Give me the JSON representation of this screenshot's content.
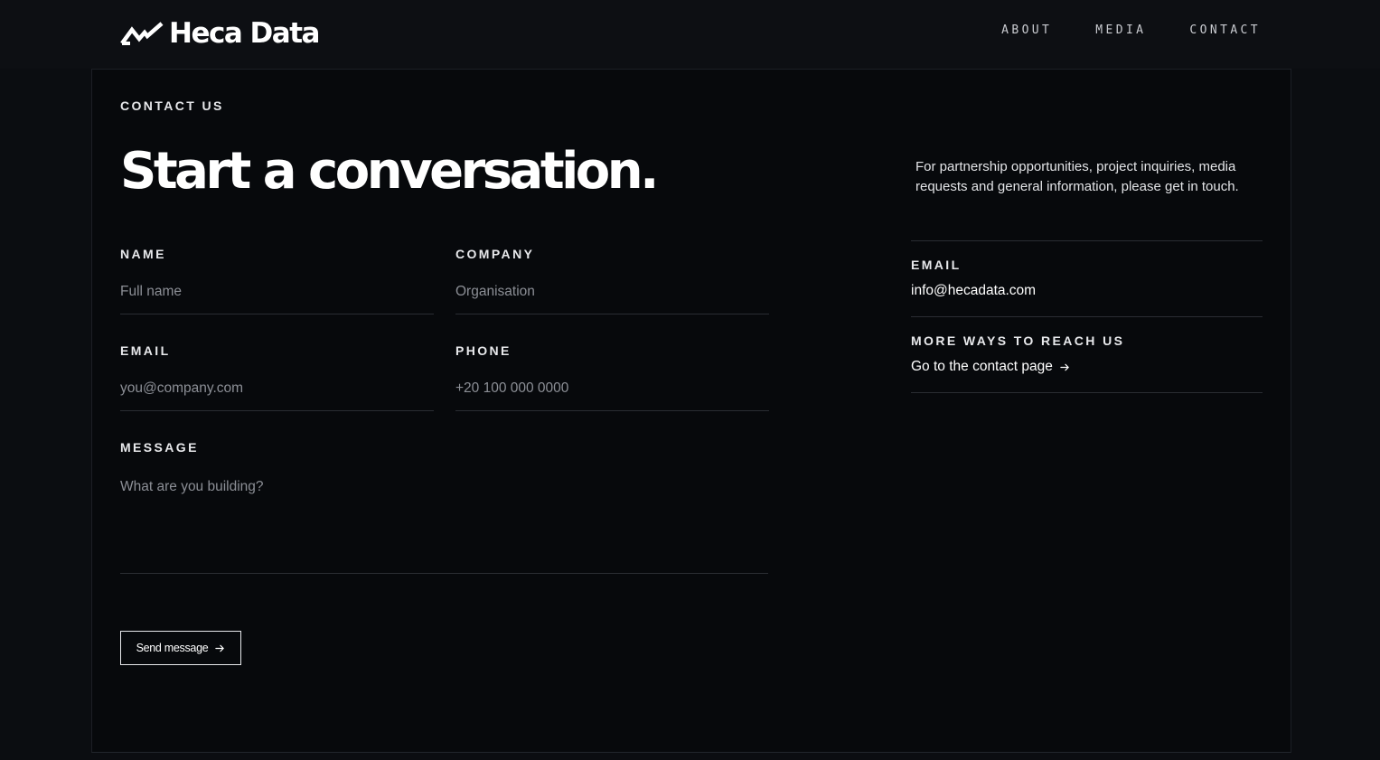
{
  "brand": {
    "name": "Heca Data",
    "logo_icon": "heca-mark-icon"
  },
  "nav": {
    "items": [
      {
        "label": "ABOUT"
      },
      {
        "label": "MEDIA"
      },
      {
        "label": "CONTACT"
      }
    ]
  },
  "hero": {
    "eyebrow": "CONTACT US",
    "title": "Start a conversation."
  },
  "form": {
    "name": {
      "label": "NAME",
      "placeholder": "Full name"
    },
    "company": {
      "label": "COMPANY",
      "placeholder": "Organisation"
    },
    "email": {
      "label": "EMAIL",
      "placeholder": "you@company.com"
    },
    "phone": {
      "label": "PHONE",
      "placeholder": "+20 100 000 0000"
    },
    "message": {
      "label": "MESSAGE",
      "placeholder": "What are you building?"
    },
    "submit_label": "Send message",
    "submit_icon": "arrow-right-icon"
  },
  "sidebar": {
    "intro": "For partnership opportunities, project inquiries, media requests and general information, please get in touch.",
    "email_label": "EMAIL",
    "email_value": "info@hecadata.com",
    "more_label": "MORE WAYS TO REACH US",
    "more_link": "Go to the contact page",
    "more_icon": "arrow-right-icon"
  },
  "colors": {
    "background": "#0b0d11",
    "panel": "#07090c",
    "text": "#ffffff",
    "muted": "#8c8f96",
    "rule": "#2a2d33"
  }
}
